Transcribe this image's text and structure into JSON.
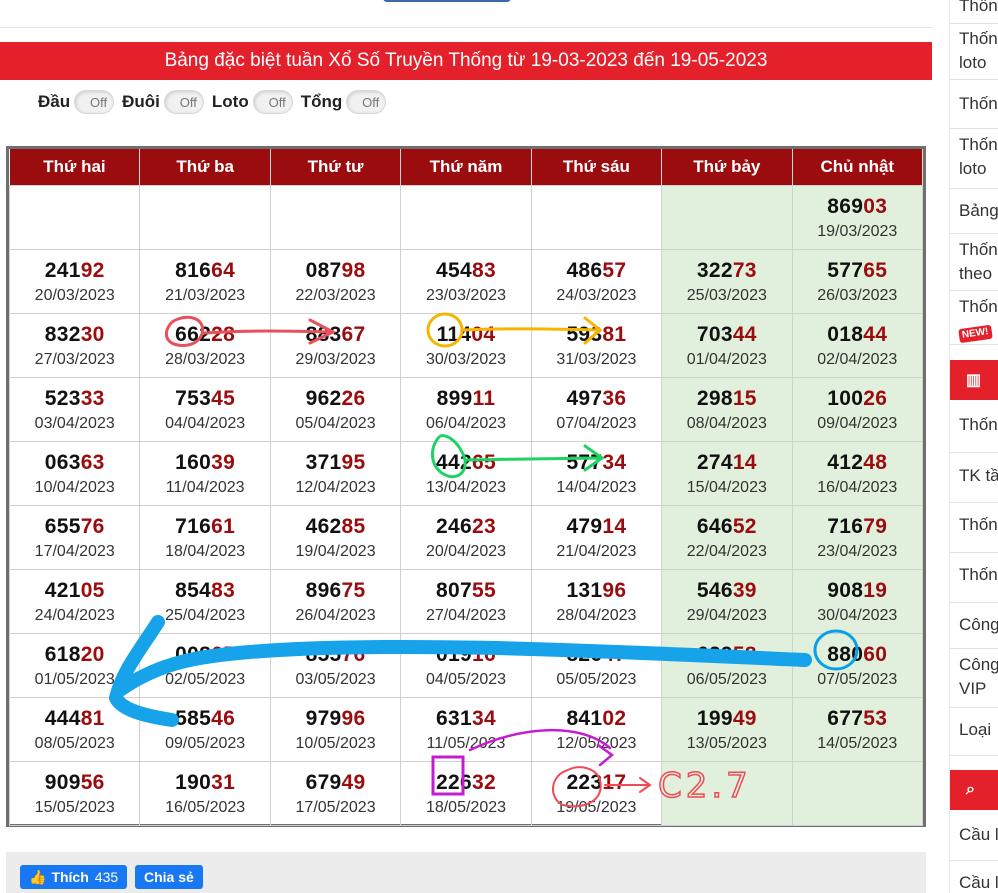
{
  "title": "Bảng đặc biệt tuần Xổ Số Truyền Thống từ 19-03-2023 đến 19-05-2023",
  "toggles": [
    {
      "label": "Đầu",
      "state": "Off"
    },
    {
      "label": "Đuôi",
      "state": "Off"
    },
    {
      "label": "Loto",
      "state": "Off"
    },
    {
      "label": "Tổng",
      "state": "Off"
    }
  ],
  "columns": [
    "Thứ hai",
    "Thứ ba",
    "Thứ tư",
    "Thứ năm",
    "Thứ sáu",
    "Thứ bảy",
    "Chủ nhật"
  ],
  "rows": [
    [
      null,
      null,
      null,
      null,
      null,
      null,
      {
        "num": "86903",
        "date": "19/03/2023"
      }
    ],
    [
      {
        "num": "24192",
        "date": "20/03/2023"
      },
      {
        "num": "81664",
        "date": "21/03/2023"
      },
      {
        "num": "08798",
        "date": "22/03/2023"
      },
      {
        "num": "45483",
        "date": "23/03/2023"
      },
      {
        "num": "48657",
        "date": "24/03/2023"
      },
      {
        "num": "32273",
        "date": "25/03/2023"
      },
      {
        "num": "57765",
        "date": "26/03/2023"
      }
    ],
    [
      {
        "num": "83230",
        "date": "27/03/2023"
      },
      {
        "num": "66228",
        "date": "28/03/2023"
      },
      {
        "num": "88367",
        "date": "29/03/2023"
      },
      {
        "num": "11404",
        "date": "30/03/2023"
      },
      {
        "num": "59381",
        "date": "31/03/2023"
      },
      {
        "num": "70344",
        "date": "01/04/2023"
      },
      {
        "num": "01844",
        "date": "02/04/2023"
      }
    ],
    [
      {
        "num": "52333",
        "date": "03/04/2023"
      },
      {
        "num": "75345",
        "date": "04/04/2023"
      },
      {
        "num": "96226",
        "date": "05/04/2023"
      },
      {
        "num": "89911",
        "date": "06/04/2023"
      },
      {
        "num": "49736",
        "date": "07/04/2023"
      },
      {
        "num": "29815",
        "date": "08/04/2023"
      },
      {
        "num": "10026",
        "date": "09/04/2023"
      }
    ],
    [
      {
        "num": "06363",
        "date": "10/04/2023"
      },
      {
        "num": "16039",
        "date": "11/04/2023"
      },
      {
        "num": "37195",
        "date": "12/04/2023"
      },
      {
        "num": "44265",
        "date": "13/04/2023"
      },
      {
        "num": "57734",
        "date": "14/04/2023"
      },
      {
        "num": "27414",
        "date": "15/04/2023"
      },
      {
        "num": "41248",
        "date": "16/04/2023"
      }
    ],
    [
      {
        "num": "65576",
        "date": "17/04/2023"
      },
      {
        "num": "71661",
        "date": "18/04/2023"
      },
      {
        "num": "46285",
        "date": "19/04/2023"
      },
      {
        "num": "24623",
        "date": "20/04/2023"
      },
      {
        "num": "47914",
        "date": "21/04/2023"
      },
      {
        "num": "64652",
        "date": "22/04/2023"
      },
      {
        "num": "71679",
        "date": "23/04/2023"
      }
    ],
    [
      {
        "num": "42105",
        "date": "24/04/2023"
      },
      {
        "num": "85483",
        "date": "25/04/2023"
      },
      {
        "num": "89675",
        "date": "26/04/2023"
      },
      {
        "num": "80755",
        "date": "27/04/2023"
      },
      {
        "num": "13196",
        "date": "28/04/2023"
      },
      {
        "num": "54639",
        "date": "29/04/2023"
      },
      {
        "num": "90819",
        "date": "30/04/2023"
      }
    ],
    [
      {
        "num": "61820",
        "date": "01/05/2023"
      },
      {
        "num": "00865",
        "date": "02/05/2023"
      },
      {
        "num": "85576",
        "date": "03/05/2023"
      },
      {
        "num": "01916",
        "date": "04/05/2023"
      },
      {
        "num": "82647",
        "date": "05/05/2023"
      },
      {
        "num": "62958",
        "date": "06/05/2023"
      },
      {
        "num": "88060",
        "date": "07/05/2023"
      }
    ],
    [
      {
        "num": "44481",
        "date": "08/05/2023"
      },
      {
        "num": "58546",
        "date": "09/05/2023"
      },
      {
        "num": "97996",
        "date": "10/05/2023"
      },
      {
        "num": "63134",
        "date": "11/05/2023"
      },
      {
        "num": "84102",
        "date": "12/05/2023"
      },
      {
        "num": "19949",
        "date": "13/05/2023"
      },
      {
        "num": "67753",
        "date": "14/05/2023"
      }
    ],
    [
      {
        "num": "90956",
        "date": "15/05/2023"
      },
      {
        "num": "19031",
        "date": "16/05/2023"
      },
      {
        "num": "67949",
        "date": "17/05/2023"
      },
      {
        "num": "22632",
        "date": "18/05/2023"
      },
      {
        "num": "22317",
        "date": "19/05/2023"
      },
      null,
      null
    ]
  ],
  "annotation_text": "C2.7",
  "social": {
    "like_label": "Thích",
    "like_count": "435",
    "share_label": "Chia sẻ"
  },
  "sidebar": {
    "items": [
      "Thốn",
      "Thốn loto",
      "Thốn",
      "Thốn loto",
      "Bảng",
      "Thốn theo",
      "Thốn",
      "Thốn",
      "TK tầ",
      "Thốn",
      "Thốn",
      "Công",
      "Công VIP",
      "Loại"
    ],
    "new_badge": "NEW!",
    "cau_items": [
      "Cầu l",
      "Cầu l"
    ]
  },
  "colors": {
    "brand_red": "#e4202b",
    "header_dark_red": "#9b0c0f",
    "weekend_green": "#e0f0dc",
    "fb_blue": "#1877f2"
  }
}
